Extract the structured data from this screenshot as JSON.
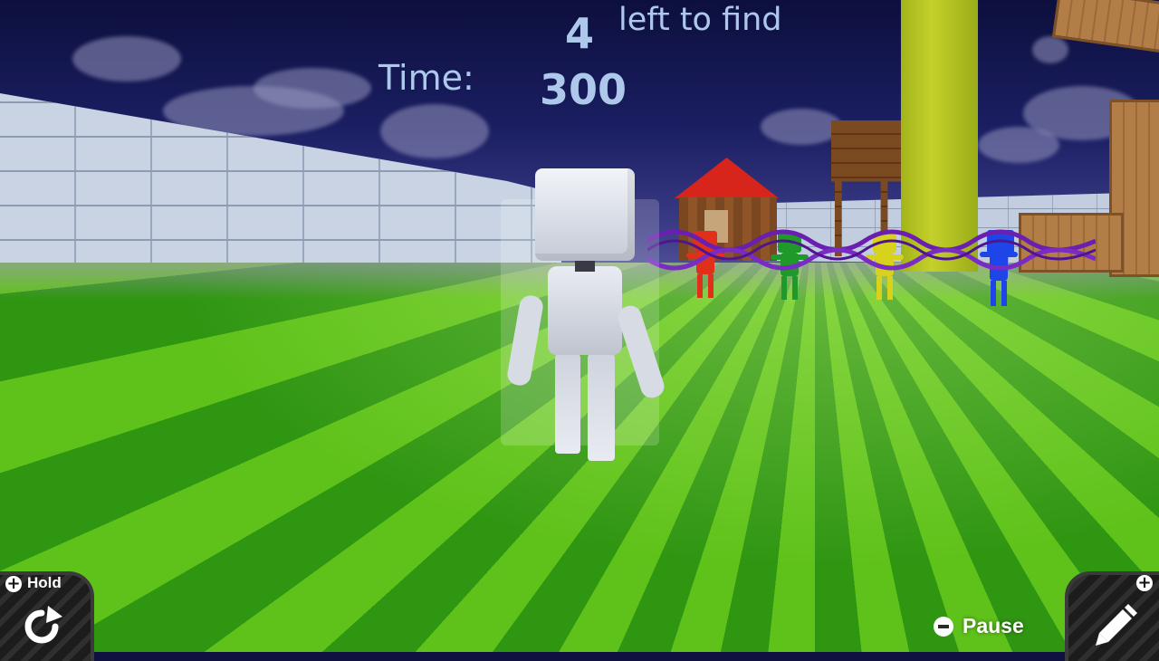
{
  "hud": {
    "remaining_count": "4",
    "remaining_label": "left to find",
    "time_label": "Time:",
    "time_value": "300"
  },
  "controls": {
    "hold_label": "Hold",
    "hold_plus": "+",
    "edit_plus": "+",
    "pause_label": "Pause"
  },
  "icons": {
    "rotate": "rotate-icon",
    "edit": "pencil-icon",
    "minus": "minus-button-icon",
    "plus": "plus-button-icon"
  },
  "bots": [
    {
      "color": "red",
      "hex": "#e0301c"
    },
    {
      "color": "green",
      "hex": "#1f9a2a"
    },
    {
      "color": "yellow",
      "hex": "#d8d21c"
    },
    {
      "color": "blue",
      "hex": "#1d45e8"
    }
  ],
  "colors": {
    "hud_text": "#aec8ec",
    "sky": "#1b1f63",
    "grass_light": "#5fc21a",
    "grass_dark": "#2f9612",
    "rope": "#6a1fb0"
  }
}
